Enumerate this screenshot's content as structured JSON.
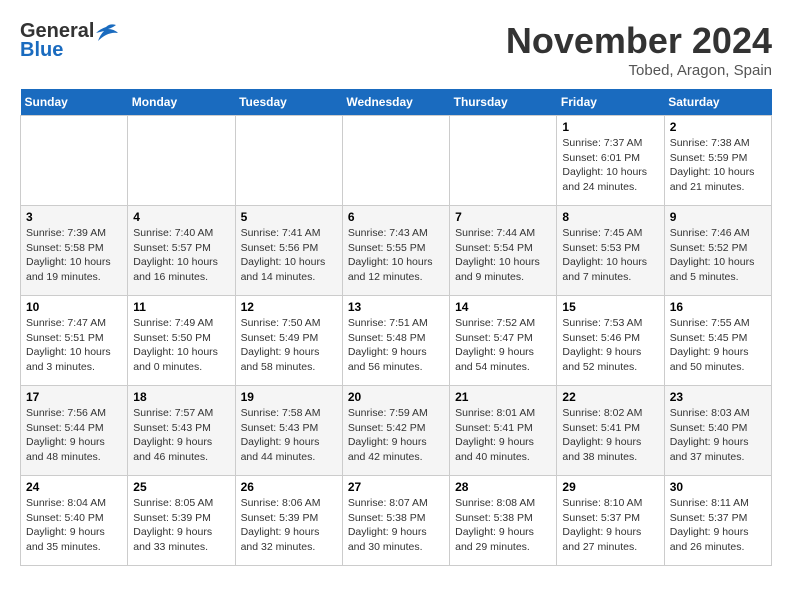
{
  "header": {
    "logo_general": "General",
    "logo_blue": "Blue",
    "month_title": "November 2024",
    "location": "Tobed, Aragon, Spain"
  },
  "weekdays": [
    "Sunday",
    "Monday",
    "Tuesday",
    "Wednesday",
    "Thursday",
    "Friday",
    "Saturday"
  ],
  "weeks": [
    [
      {
        "day": "",
        "info": ""
      },
      {
        "day": "",
        "info": ""
      },
      {
        "day": "",
        "info": ""
      },
      {
        "day": "",
        "info": ""
      },
      {
        "day": "",
        "info": ""
      },
      {
        "day": "1",
        "info": "Sunrise: 7:37 AM\nSunset: 6:01 PM\nDaylight: 10 hours and 24 minutes."
      },
      {
        "day": "2",
        "info": "Sunrise: 7:38 AM\nSunset: 5:59 PM\nDaylight: 10 hours and 21 minutes."
      }
    ],
    [
      {
        "day": "3",
        "info": "Sunrise: 7:39 AM\nSunset: 5:58 PM\nDaylight: 10 hours and 19 minutes."
      },
      {
        "day": "4",
        "info": "Sunrise: 7:40 AM\nSunset: 5:57 PM\nDaylight: 10 hours and 16 minutes."
      },
      {
        "day": "5",
        "info": "Sunrise: 7:41 AM\nSunset: 5:56 PM\nDaylight: 10 hours and 14 minutes."
      },
      {
        "day": "6",
        "info": "Sunrise: 7:43 AM\nSunset: 5:55 PM\nDaylight: 10 hours and 12 minutes."
      },
      {
        "day": "7",
        "info": "Sunrise: 7:44 AM\nSunset: 5:54 PM\nDaylight: 10 hours and 9 minutes."
      },
      {
        "day": "8",
        "info": "Sunrise: 7:45 AM\nSunset: 5:53 PM\nDaylight: 10 hours and 7 minutes."
      },
      {
        "day": "9",
        "info": "Sunrise: 7:46 AM\nSunset: 5:52 PM\nDaylight: 10 hours and 5 minutes."
      }
    ],
    [
      {
        "day": "10",
        "info": "Sunrise: 7:47 AM\nSunset: 5:51 PM\nDaylight: 10 hours and 3 minutes."
      },
      {
        "day": "11",
        "info": "Sunrise: 7:49 AM\nSunset: 5:50 PM\nDaylight: 10 hours and 0 minutes."
      },
      {
        "day": "12",
        "info": "Sunrise: 7:50 AM\nSunset: 5:49 PM\nDaylight: 9 hours and 58 minutes."
      },
      {
        "day": "13",
        "info": "Sunrise: 7:51 AM\nSunset: 5:48 PM\nDaylight: 9 hours and 56 minutes."
      },
      {
        "day": "14",
        "info": "Sunrise: 7:52 AM\nSunset: 5:47 PM\nDaylight: 9 hours and 54 minutes."
      },
      {
        "day": "15",
        "info": "Sunrise: 7:53 AM\nSunset: 5:46 PM\nDaylight: 9 hours and 52 minutes."
      },
      {
        "day": "16",
        "info": "Sunrise: 7:55 AM\nSunset: 5:45 PM\nDaylight: 9 hours and 50 minutes."
      }
    ],
    [
      {
        "day": "17",
        "info": "Sunrise: 7:56 AM\nSunset: 5:44 PM\nDaylight: 9 hours and 48 minutes."
      },
      {
        "day": "18",
        "info": "Sunrise: 7:57 AM\nSunset: 5:43 PM\nDaylight: 9 hours and 46 minutes."
      },
      {
        "day": "19",
        "info": "Sunrise: 7:58 AM\nSunset: 5:43 PM\nDaylight: 9 hours and 44 minutes."
      },
      {
        "day": "20",
        "info": "Sunrise: 7:59 AM\nSunset: 5:42 PM\nDaylight: 9 hours and 42 minutes."
      },
      {
        "day": "21",
        "info": "Sunrise: 8:01 AM\nSunset: 5:41 PM\nDaylight: 9 hours and 40 minutes."
      },
      {
        "day": "22",
        "info": "Sunrise: 8:02 AM\nSunset: 5:41 PM\nDaylight: 9 hours and 38 minutes."
      },
      {
        "day": "23",
        "info": "Sunrise: 8:03 AM\nSunset: 5:40 PM\nDaylight: 9 hours and 37 minutes."
      }
    ],
    [
      {
        "day": "24",
        "info": "Sunrise: 8:04 AM\nSunset: 5:40 PM\nDaylight: 9 hours and 35 minutes."
      },
      {
        "day": "25",
        "info": "Sunrise: 8:05 AM\nSunset: 5:39 PM\nDaylight: 9 hours and 33 minutes."
      },
      {
        "day": "26",
        "info": "Sunrise: 8:06 AM\nSunset: 5:39 PM\nDaylight: 9 hours and 32 minutes."
      },
      {
        "day": "27",
        "info": "Sunrise: 8:07 AM\nSunset: 5:38 PM\nDaylight: 9 hours and 30 minutes."
      },
      {
        "day": "28",
        "info": "Sunrise: 8:08 AM\nSunset: 5:38 PM\nDaylight: 9 hours and 29 minutes."
      },
      {
        "day": "29",
        "info": "Sunrise: 8:10 AM\nSunset: 5:37 PM\nDaylight: 9 hours and 27 minutes."
      },
      {
        "day": "30",
        "info": "Sunrise: 8:11 AM\nSunset: 5:37 PM\nDaylight: 9 hours and 26 minutes."
      }
    ]
  ]
}
